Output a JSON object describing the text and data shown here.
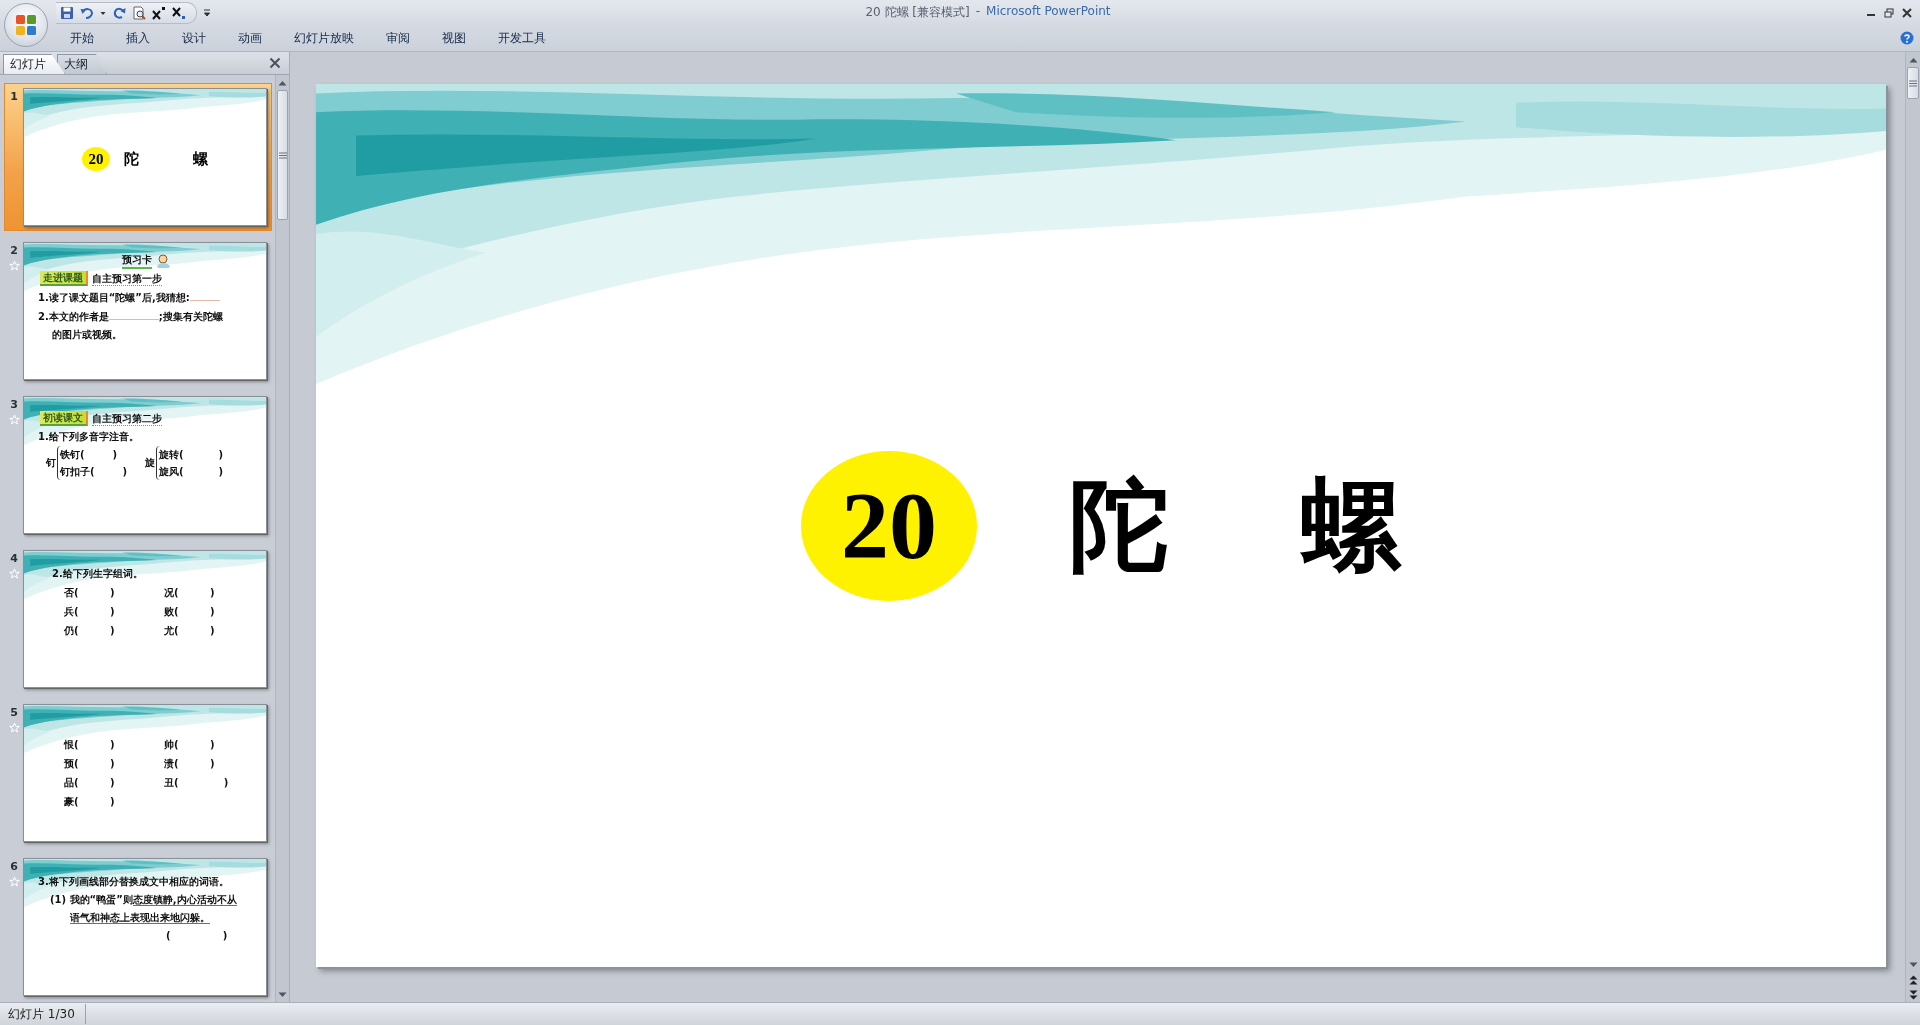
{
  "window": {
    "title": "20 陀螺 [兼容模式]",
    "separator": "-",
    "app_name": "Microsoft PowerPoint"
  },
  "ribbon_tabs": [
    {
      "label": "开始",
      "selected": false
    },
    {
      "label": "插入",
      "selected": false
    },
    {
      "label": "设计",
      "selected": false
    },
    {
      "label": "动画",
      "selected": false
    },
    {
      "label": "幻灯片放映",
      "selected": false
    },
    {
      "label": "审阅",
      "selected": false
    },
    {
      "label": "视图",
      "selected": false
    },
    {
      "label": "开发工具",
      "selected": false
    }
  ],
  "panel_tabs": [
    {
      "label": "幻灯片",
      "selected": true
    },
    {
      "label": "大纲",
      "selected": false
    }
  ],
  "slides": [
    {
      "number": "1",
      "selected": true,
      "animated": false,
      "blocks": [
        {
          "kind": "title",
          "badge": "20",
          "words": [
            "陀",
            "螺"
          ]
        }
      ]
    },
    {
      "number": "2",
      "selected": false,
      "animated": true,
      "blocks": [
        {
          "kind": "header",
          "text": "预习卡"
        },
        {
          "kind": "tag",
          "label": "走进课题",
          "note": "自主预习第一步"
        },
        {
          "kind": "fill",
          "before": "1.读了课文题目“陀螺”后,我猜想:"
        },
        {
          "kind": "fill",
          "before": "2.本文的作者是",
          "after": ";搜集有关陀螺"
        },
        {
          "kind": "line",
          "text": "的图片或视频。",
          "indent": true
        }
      ]
    },
    {
      "number": "3",
      "selected": false,
      "animated": true,
      "blocks": [
        {
          "kind": "tag",
          "label": "初读课文",
          "note": "自主预习第二步"
        },
        {
          "kind": "line",
          "text": "1.给下列多音字注音。",
          "indent": false
        },
        {
          "kind": "braces",
          "groups": [
            {
              "char": "钉",
              "items": [
                "铁钉(        )",
                "钉扣子(        )"
              ]
            },
            {
              "char": "旋",
              "items": [
                "旋转(          )",
                "旋风(          )"
              ]
            }
          ]
        }
      ]
    },
    {
      "number": "4",
      "selected": false,
      "animated": true,
      "blocks": [
        {
          "kind": "line",
          "text": "2.给下列生字组词。",
          "indent": true
        },
        {
          "kind": "grid",
          "items": [
            "否(         )",
            "况(         )",
            "兵(         )",
            "败(         )",
            "仍(         )",
            "尤(         )"
          ]
        }
      ]
    },
    {
      "number": "5",
      "selected": false,
      "animated": true,
      "blocks": [
        {
          "kind": "grid",
          "items": [
            "恨(         )",
            "帅(         )",
            "预(         )",
            "溃(         )",
            "品(         )",
            "丑(             )",
            "豪(         )"
          ]
        }
      ]
    },
    {
      "number": "6",
      "selected": false,
      "animated": true,
      "blocks": [
        {
          "kind": "line",
          "text": "3.将下列画线部分替换成文中相应的词语。",
          "indent": false
        },
        {
          "kind": "underlined",
          "lead": "(1) 我的“鸭蛋”则",
          "text": "态度镇静,内心活动不从"
        },
        {
          "kind": "underlined",
          "text": "语气和神态上表现出来地闪躲。"
        },
        {
          "kind": "answer",
          "text": "(               )"
        }
      ]
    }
  ],
  "current_slide": {
    "blocks": [
      {
        "kind": "title",
        "badge": "20",
        "words": [
          "陀",
          "螺"
        ]
      }
    ]
  },
  "status_bar": {
    "slide_indicator": "幻灯片 1/30"
  }
}
